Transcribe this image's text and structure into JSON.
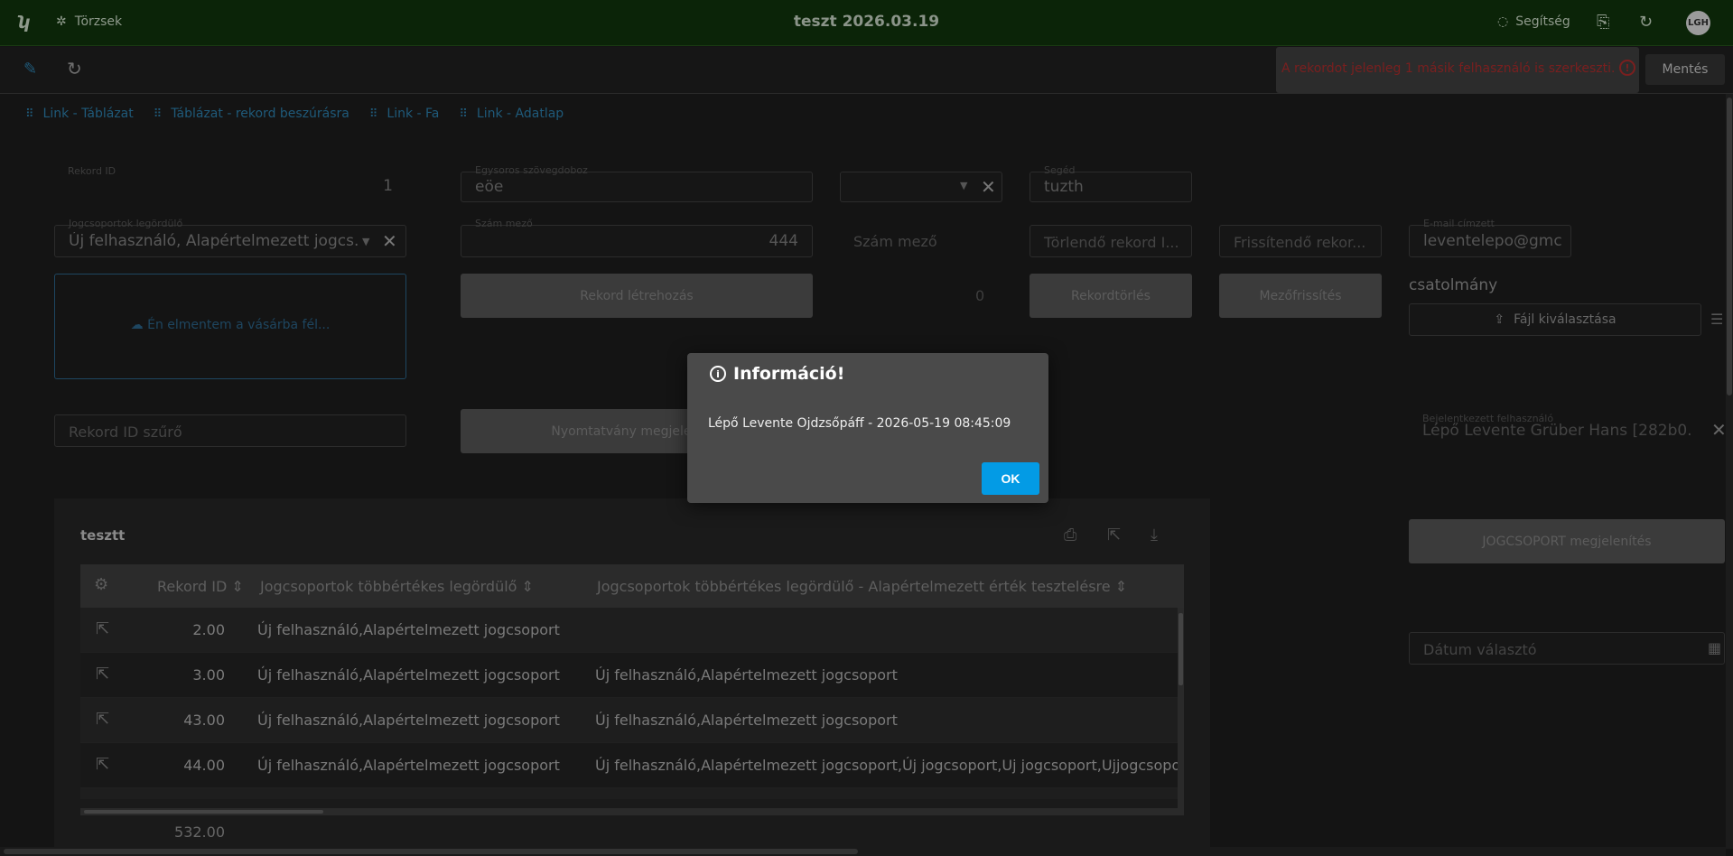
{
  "topbar": {
    "logo": "ʮ",
    "menu_label": "Törzsek",
    "title": "teszt 2026.03.19",
    "help_label": "Segítség",
    "avatar_initials": "LGH"
  },
  "toolbar": {
    "warning_text": "A rekordot jelenleg 1 másik felhasználó is szerkeszti.",
    "save_label": "Mentés"
  },
  "links": [
    {
      "label": "Link - Táblázat"
    },
    {
      "label": "Táblázat - rekord beszúrásra"
    },
    {
      "label": "Link - Fa"
    },
    {
      "label": "Link - Adatlap"
    }
  ],
  "form": {
    "record_id": {
      "label": "Rekord ID",
      "value": "1"
    },
    "single_text": {
      "label": "Egysoros szövegdoboz",
      "value": "eöe"
    },
    "seged": {
      "label": "Segéd",
      "value": "tuzth"
    },
    "role_dropdown": {
      "label": "Jogcsoportok legördülő",
      "value": "Új felhasználó, Alapértelmezett jogcs..."
    },
    "number_field": {
      "label": "Szám mező",
      "value": "444"
    },
    "number_field2": {
      "placeholder": "Szám mező",
      "value": "0"
    },
    "delete_record": {
      "placeholder": "Törlendő rekord I..."
    },
    "refresh_record": {
      "placeholder": "Frissítendő rekor..."
    },
    "email": {
      "label": "E-mail címzett",
      "value": "leventelepo@gmc"
    },
    "attachment_label": "csatolmány",
    "file_button": "Fájl kiválasztása",
    "upload_area": "Én elmentem a vásárba fél...",
    "create_record": "Rekord létrehozás",
    "delete_button": "Rekordtörlés",
    "field_refresh": "Mezőfrissítés",
    "record_filter": {
      "placeholder": "Rekord ID szűrő"
    },
    "print_form": "Nyomtatvány megjelenítés",
    "logged_user": {
      "label": "Bejelentkezett felhasználó",
      "value": "Lépő Levente Grüber Hans [282b0..."
    },
    "jogcsoport_button": "JOGCSOPORT megjelenítés",
    "date_picker": {
      "placeholder": "Dátum választó"
    }
  },
  "table": {
    "title": "tesztt",
    "headers": [
      "Rekord ID",
      "Jogcsoportok többértékes legördülő",
      "Jogcsoportok többértékes legördülő - Alapértelmezett érték tesztelésre"
    ],
    "rows": [
      {
        "id": "2.00",
        "c1": "Új felhasználó,Alapértelmezett jogcsoport",
        "c2": ""
      },
      {
        "id": "3.00",
        "c1": "Új felhasználó,Alapértelmezett jogcsoport",
        "c2": "Új felhasználó,Alapértelmezett jogcsoport"
      },
      {
        "id": "43.00",
        "c1": "Új felhasználó,Alapértelmezett jogcsoport",
        "c2": "Új felhasználó,Alapértelmezett jogcsoport"
      },
      {
        "id": "44.00",
        "c1": "Új felhasználó,Alapértelmezett jogcsoport",
        "c2": "Új felhasználó,Alapértelmezett jogcsoport,Új jogcsoport,Uj jogcsoport,Ujjogcsoport"
      }
    ],
    "footer_sum": "532.00"
  },
  "modal": {
    "title": "Információ!",
    "message": "Lépő Levente Ojdzsőpáff - 2026-05-19 08:45:09",
    "ok_label": "OK"
  },
  "colors": {
    "topbar_bg": "#0b2408",
    "accent_blue": "#039be5",
    "warning_red": "#7a1f1f"
  }
}
